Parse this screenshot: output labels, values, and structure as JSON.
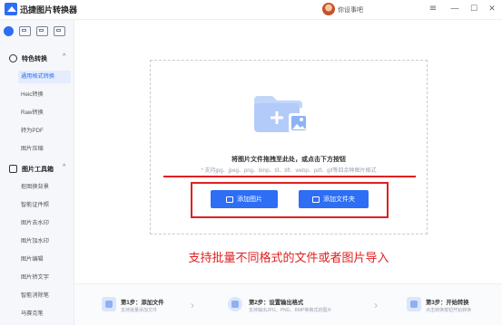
{
  "window": {
    "app_title": "迅捷图片转换器",
    "user_name": "你设事吧",
    "controls": {
      "menu": "≡",
      "minimize": "—",
      "maximize": "☐",
      "close": "✕"
    }
  },
  "sidebar": {
    "group1": {
      "label": "特色转换",
      "caret": "^"
    },
    "group1_items": [
      {
        "label": "通用格式转换"
      },
      {
        "label": "Heic转换"
      },
      {
        "label": "Raw转换"
      },
      {
        "label": "转为PDF"
      },
      {
        "label": "图片压缩"
      }
    ],
    "group2": {
      "label": "图片工具箱",
      "caret": "^"
    },
    "group2_items": [
      {
        "label": "抠图换背景"
      },
      {
        "label": "智能证件照"
      },
      {
        "label": "图片去水印"
      },
      {
        "label": "图片加水印"
      },
      {
        "label": "图片编辑"
      },
      {
        "label": "图片转文字"
      },
      {
        "label": "智能消除笔"
      },
      {
        "label": "马赛克笔"
      }
    ]
  },
  "dropzone": {
    "title": "将图片文件拖拽至此处，或点击下方按钮",
    "hint": "* 支持jpg、jpeg、png、bmp、tif、tiff、webp、pdf、gif等四余种图片格式",
    "add_image_label": "添加图片",
    "add_folder_label": "添加文件夹"
  },
  "annotation": "支持批量不同格式的文件或者图片导入",
  "steps": [
    {
      "title": "第1步：添加文件",
      "desc": "支持批量添加文件"
    },
    {
      "title": "第2步：设置输出格式",
      "desc": "支持输出JPG、PNG、BMP等格式的图片"
    },
    {
      "title": "第3步：开始转换",
      "desc": "点击转换按钮开始转换"
    }
  ],
  "colors": {
    "accent": "#2d6ef5",
    "annotation_red": "#e02020"
  }
}
